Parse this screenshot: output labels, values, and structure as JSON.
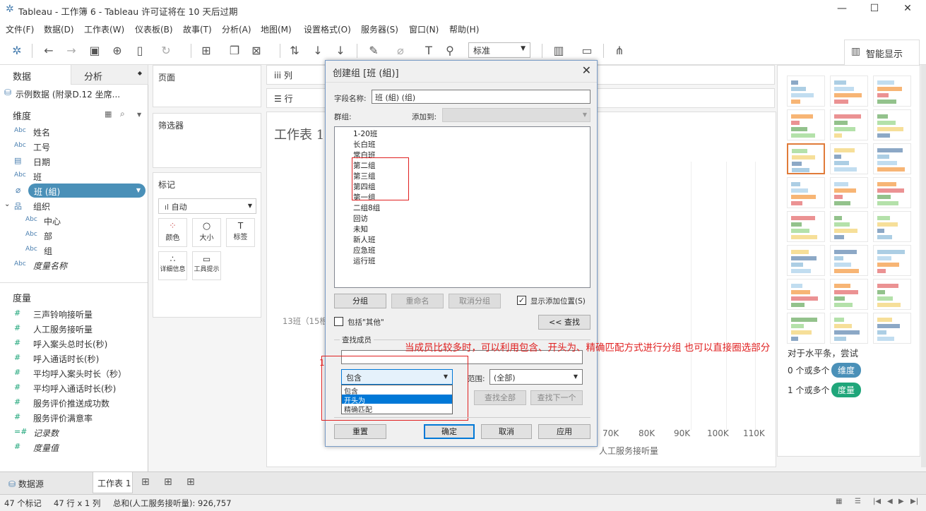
{
  "window": {
    "title": "Tableau - 工作簿 6 - Tableau 许可证将在 10 天后过期"
  },
  "menu": [
    "文件(F)",
    "数据(D)",
    "工作表(W)",
    "仪表板(B)",
    "故事(T)",
    "分析(A)",
    "地图(M)",
    "设置格式(O)",
    "服务器(S)",
    "窗口(N)",
    "帮助(H)"
  ],
  "toolbar": {
    "fit": "标准",
    "smart": "智能显示"
  },
  "left": {
    "tab_data": "数据",
    "tab_analysis": "分析",
    "datasource": "示例数据 (附录D.12 坐席...",
    "dimensions_title": "维度",
    "dimensions": [
      {
        "icon": "Abc",
        "label": "姓名"
      },
      {
        "icon": "Abc",
        "label": "工号"
      },
      {
        "icon": "calendar",
        "label": "日期"
      },
      {
        "icon": "Abc",
        "label": "班"
      },
      {
        "icon": "paperclip",
        "label": "班 (組)"
      },
      {
        "icon": "hierarchy",
        "label": "组织"
      },
      {
        "icon": "Abc",
        "label": "中心"
      },
      {
        "icon": "Abc",
        "label": "部"
      },
      {
        "icon": "Abc",
        "label": "组"
      },
      {
        "icon": "Abc",
        "label": "度量名称"
      }
    ],
    "measures_title": "度量",
    "measures": [
      "三声铃响接听量",
      "人工服务接听量",
      "呼入案头总时长(秒)",
      "呼入通话时长(秒)",
      "平均呼入案头时长（秒）",
      "平均呼入通话时长(秒)",
      "服务评价推送成功数",
      "服务评价满意率",
      "记录数",
      "度量值"
    ]
  },
  "shelves": {
    "pages": "页面",
    "filters": "筛选器",
    "marks": "标记",
    "columns": "列",
    "rows": "行",
    "mark_type": "自动",
    "color": "颜色",
    "size": "大小",
    "label": "标签",
    "detail": "详细信息",
    "tooltip": "工具提示"
  },
  "canvas": {
    "sheet_title": "工作表 1",
    "row_label": "13班（15根",
    "x_ticks": [
      "70K",
      "80K",
      "90K",
      "100K",
      "110K"
    ],
    "x_axis_title": "人工服务接听量"
  },
  "right": {
    "hint": "对于水平条，尝试",
    "dim_text": "0 个或多个",
    "dim_tag": "维度",
    "mea_text": "1 个或多个",
    "mea_tag": "度量"
  },
  "dialog": {
    "title": "创建组 [班 (組)]",
    "field_label": "字段名称:",
    "field_value": "班 (組) (组)",
    "group_label": "群组:",
    "add_to_label": "添加到:",
    "groups": [
      "1-20班",
      "长白班",
      "常白班",
      "第二组",
      "第三组",
      "第四组",
      "第一组",
      "二组8组",
      "回访",
      "未知",
      "新人班",
      "应急班",
      "运行班"
    ],
    "btn_group": "分组",
    "btn_rename": "重命名",
    "btn_ungroup": "取消分组",
    "show_add": "显示添加位置(S)",
    "include_other": "包括\"其他\"",
    "btn_find": "<< 查找",
    "find_title": "查找成员",
    "match_value": "包含",
    "match_options": [
      "包含",
      "开头为",
      "精确匹配"
    ],
    "range_label": "范围:",
    "range_value": "(全部)",
    "btn_find_all": "查找全部",
    "btn_find_next": "查找下一个",
    "btn_reset": "重置",
    "btn_ok": "确定",
    "btn_cancel": "取消",
    "btn_apply": "应用"
  },
  "annotation": "当成员比较多时，可以利用包含、开头为、精确匹配方式进行分组 也可以直接圈选部分",
  "bottom": {
    "datasource_tab": "数据源",
    "sheet_tab": "工作表 1"
  },
  "status": {
    "marks": "47 个标记",
    "rows": "47 行 x 1 列",
    "sum": "总和(人工服务接听量): 926,757"
  },
  "colors": {
    "accent": "#4a90b8",
    "dim_tag": "#4a90b8",
    "mea_tag": "#1fa67a",
    "annot": "#e02020"
  }
}
